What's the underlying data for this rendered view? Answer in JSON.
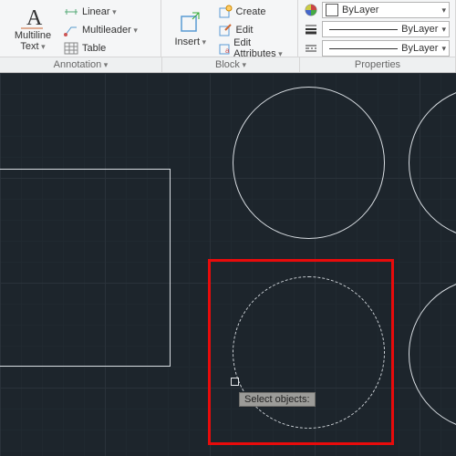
{
  "ribbon": {
    "annotation": {
      "multiline_text": "Multiline Text",
      "linear": "Linear",
      "multileader": "Multileader",
      "table": "Table",
      "tab": "Annotation"
    },
    "block": {
      "insert": "Insert",
      "create": "Create",
      "edit": "Edit",
      "edit_attributes": "Edit Attributes",
      "tab": "Block"
    },
    "properties": {
      "color": "ByLayer",
      "lineweight": "ByLayer",
      "linetype": "ByLayer",
      "tab": "Properties"
    }
  },
  "canvas": {
    "tooltip": "Select objects:"
  }
}
